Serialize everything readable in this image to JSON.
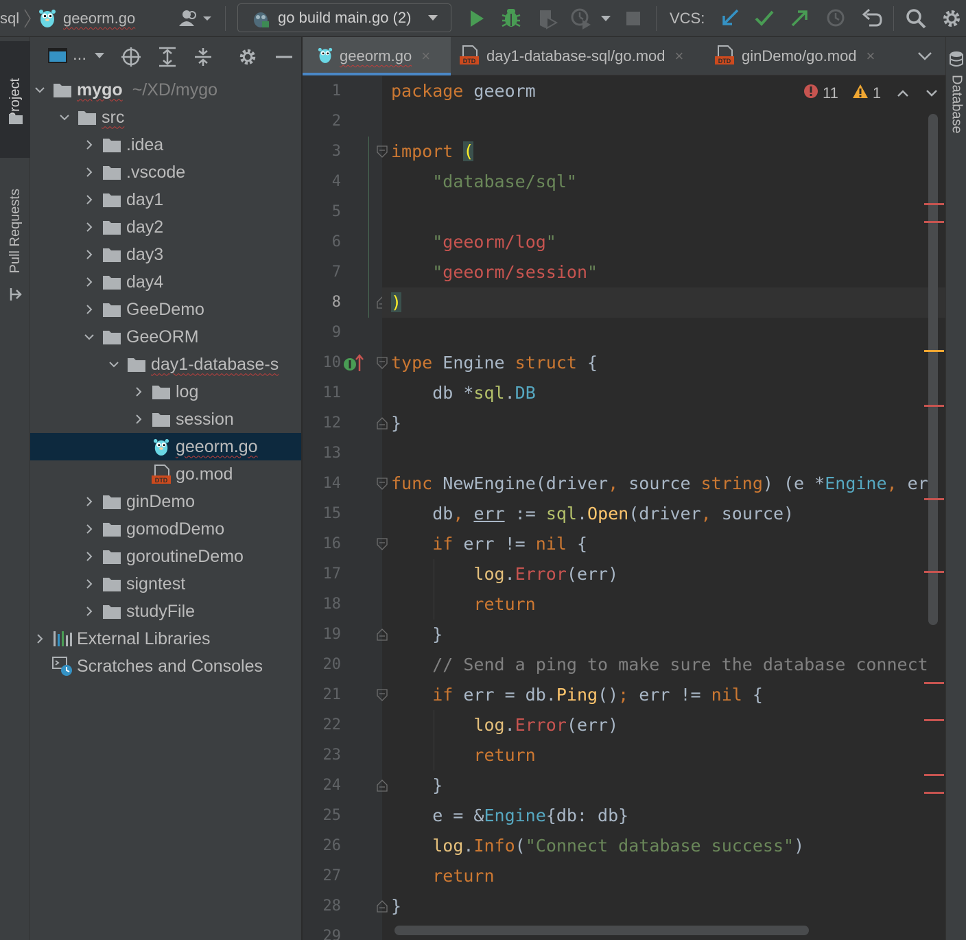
{
  "toolbar": {
    "breadcrumb_project": "sql",
    "current_file": "geeorm.go",
    "run_config": "go build main.go (2)",
    "vcs_label": "VCS:"
  },
  "left_strip": {
    "project_tab": "Project",
    "pull_requests_tab": "Pull Requests"
  },
  "right_strip": {
    "database_tab": "Database"
  },
  "project_panel": {
    "view_selector": "..."
  },
  "tree": [
    {
      "name": "mygo",
      "sub": "~/XD/mygo",
      "type": "folder",
      "level": 0,
      "expanded": true
    },
    {
      "name": "src",
      "type": "folder",
      "level": 1,
      "expanded": true
    },
    {
      "name": ".idea",
      "type": "folder",
      "level": 2,
      "expanded": false
    },
    {
      "name": ".vscode",
      "type": "folder",
      "level": 2,
      "expanded": false
    },
    {
      "name": "day1",
      "type": "folder",
      "level": 2,
      "expanded": false
    },
    {
      "name": "day2",
      "type": "folder",
      "level": 2,
      "expanded": false
    },
    {
      "name": "day3",
      "type": "folder",
      "level": 2,
      "expanded": false
    },
    {
      "name": "day4",
      "type": "folder",
      "level": 2,
      "expanded": false
    },
    {
      "name": "GeeDemo",
      "type": "folder",
      "level": 2,
      "expanded": false
    },
    {
      "name": "GeeORM",
      "type": "folder",
      "level": 2,
      "expanded": true
    },
    {
      "name": "day1-database-s",
      "type": "folder",
      "level": 3,
      "expanded": true
    },
    {
      "name": "log",
      "type": "folder",
      "level": 4,
      "expanded": false
    },
    {
      "name": "session",
      "type": "folder",
      "level": 4,
      "expanded": false
    },
    {
      "name": "geeorm.go",
      "type": "go",
      "level": 4,
      "selected": true
    },
    {
      "name": "go.mod",
      "type": "mod",
      "level": 4
    },
    {
      "name": "ginDemo",
      "type": "folder",
      "level": 2,
      "expanded": false
    },
    {
      "name": "gomodDemo",
      "type": "folder",
      "level": 2,
      "expanded": false
    },
    {
      "name": "goroutineDemo",
      "type": "folder",
      "level": 2,
      "expanded": false
    },
    {
      "name": "signtest",
      "type": "folder",
      "level": 2,
      "expanded": false
    },
    {
      "name": "studyFile",
      "type": "folder",
      "level": 2,
      "expanded": false
    },
    {
      "name": "External Libraries",
      "type": "libs",
      "level": 0,
      "expanded": false
    },
    {
      "name": "Scratches and Consoles",
      "type": "scratch",
      "level": 0
    }
  ],
  "tabs": [
    {
      "label": "geeorm.go",
      "icon": "go-file-icon",
      "active": true
    },
    {
      "label": "day1-database-sql/go.mod",
      "icon": "mod-file-icon",
      "active": false
    },
    {
      "label": "ginDemo/go.mod",
      "icon": "mod-file-icon",
      "active": false
    }
  ],
  "inspection": {
    "errors": "11",
    "warnings": "1"
  },
  "editor": {
    "current_line": 8,
    "last_visible_line": "29",
    "lines": [
      [
        [
          "kw",
          "package"
        ],
        [
          "id",
          " geeorm"
        ]
      ],
      [],
      [
        [
          "kw",
          "import"
        ],
        [
          "id",
          " "
        ],
        [
          "brace-hl",
          "("
        ]
      ],
      [
        [
          "id",
          "    "
        ],
        [
          "str",
          "\"database/sql\""
        ]
      ],
      [],
      [
        [
          "id",
          "    "
        ],
        [
          "str",
          "\""
        ],
        [
          "imp",
          "geeorm/log"
        ],
        [
          "str",
          "\""
        ]
      ],
      [
        [
          "id",
          "    "
        ],
        [
          "str",
          "\""
        ],
        [
          "imp",
          "geeorm/session"
        ],
        [
          "str",
          "\""
        ]
      ],
      [
        [
          "brace-hl",
          ")"
        ]
      ],
      [],
      [
        [
          "kw",
          "type"
        ],
        [
          "id",
          " Engine "
        ],
        [
          "kw",
          "struct"
        ],
        [
          "id",
          " {"
        ]
      ],
      [
        [
          "id",
          "    db *"
        ],
        [
          "pkg",
          "sql"
        ],
        [
          "id",
          "."
        ],
        [
          "typ",
          "DB"
        ]
      ],
      [
        [
          "id",
          "}"
        ]
      ],
      [],
      [
        [
          "kw",
          "func"
        ],
        [
          "id",
          " "
        ],
        [
          "fndecl",
          "NewEngine"
        ],
        [
          "id",
          "(driver"
        ],
        [
          "kw",
          ","
        ],
        [
          "id",
          " source "
        ],
        [
          "kw",
          "string"
        ],
        [
          "id",
          ") (e *"
        ],
        [
          "typ",
          "Engine"
        ],
        [
          "kw",
          ","
        ],
        [
          "id",
          " er"
        ]
      ],
      [
        [
          "id",
          "    db"
        ],
        [
          "kw",
          ","
        ],
        [
          "id",
          " err := "
        ],
        [
          "pkg",
          "sql"
        ],
        [
          "id",
          "."
        ],
        [
          "fn",
          "Open"
        ],
        [
          "id",
          "(driver"
        ],
        [
          "kw",
          ","
        ],
        [
          "id",
          " source)"
        ]
      ],
      [
        [
          "id",
          "    "
        ],
        [
          "kw",
          "if"
        ],
        [
          "id",
          " err != "
        ],
        [
          "kw",
          "nil"
        ],
        [
          "id",
          " {"
        ]
      ],
      [
        [
          "id",
          "        "
        ],
        [
          "logcall",
          "log"
        ],
        [
          "id",
          "."
        ],
        [
          "errfn",
          "Error"
        ],
        [
          "id",
          "(err)"
        ]
      ],
      [
        [
          "id",
          "        "
        ],
        [
          "kw",
          "return"
        ]
      ],
      [
        [
          "id",
          "    }"
        ]
      ],
      [
        [
          "id",
          "    "
        ],
        [
          "cm",
          "// Send a ping to make sure the database connect"
        ]
      ],
      [
        [
          "id",
          "    "
        ],
        [
          "kw",
          "if"
        ],
        [
          "id",
          " err = db."
        ],
        [
          "fn",
          "Ping"
        ],
        [
          "id",
          "()"
        ],
        [
          "kw",
          ";"
        ],
        [
          "id",
          " err != "
        ],
        [
          "kw",
          "nil"
        ],
        [
          "id",
          " {"
        ]
      ],
      [
        [
          "id",
          "        "
        ],
        [
          "logcall",
          "log"
        ],
        [
          "id",
          "."
        ],
        [
          "errfn",
          "Error"
        ],
        [
          "id",
          "(err)"
        ]
      ],
      [
        [
          "id",
          "        "
        ],
        [
          "kw",
          "return"
        ]
      ],
      [
        [
          "id",
          "    }"
        ]
      ],
      [
        [
          "id",
          "    e = &"
        ],
        [
          "typ",
          "Engine"
        ],
        [
          "id",
          "{db: db}"
        ]
      ],
      [
        [
          "id",
          "    "
        ],
        [
          "logcall",
          "log"
        ],
        [
          "id",
          "."
        ],
        [
          "infofn",
          "Info"
        ],
        [
          "id",
          "("
        ],
        [
          "str",
          "\"Connect database success\""
        ],
        [
          "id",
          ")"
        ]
      ],
      [
        [
          "id",
          "    "
        ],
        [
          "kw",
          "return"
        ]
      ],
      [
        [
          "id",
          "}"
        ]
      ]
    ]
  },
  "colors": {
    "accent": "#4a88c7",
    "run_green": "#499c54",
    "error_red": "#c75450",
    "warning_yellow": "#f0a732",
    "vcs_update_blue": "#3592c4"
  }
}
